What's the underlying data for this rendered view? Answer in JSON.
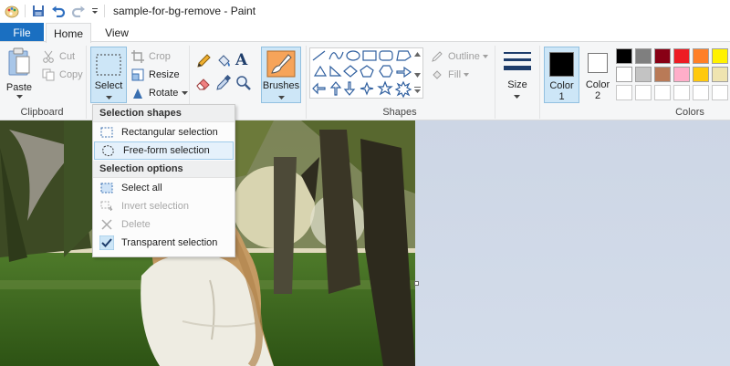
{
  "window": {
    "title": "sample-for-bg-remove - Paint"
  },
  "tabs": {
    "file": "File",
    "home": "Home",
    "view": "View"
  },
  "clipboard": {
    "paste": "Paste",
    "cut": "Cut",
    "copy": "Copy",
    "label": "Clipboard"
  },
  "image": {
    "select": "Select",
    "crop": "Crop",
    "resize": "Resize",
    "rotate": "Rotate"
  },
  "tools": {
    "brushes": "Brushes"
  },
  "shapes": {
    "outline": "Outline",
    "fill": "Fill",
    "label": "Shapes"
  },
  "size": {
    "label": "Size"
  },
  "colors": {
    "color1": "Color",
    "color1_num": "1",
    "color2": "Color",
    "color2_num": "2",
    "label": "Colors",
    "color1_value": "#000000",
    "color2_value": "#ffffff",
    "palette_row1": [
      "#000000",
      "#7f7f7f",
      "#880015",
      "#ed1c24",
      "#ff7f27",
      "#fff200"
    ],
    "palette_row2": [
      "#ffffff",
      "#c3c3c3",
      "#b97a57",
      "#ffaec9",
      "#ffc90e",
      "#efe4b0"
    ],
    "palette_row3": [
      "#ffffff",
      "#ffffff",
      "#ffffff",
      "#ffffff",
      "#ffffff",
      "#ffffff"
    ]
  },
  "select_menu": {
    "shapes_header": "Selection shapes",
    "rectangular": "Rectangular selection",
    "freeform": "Free-form selection",
    "options_header": "Selection options",
    "select_all": "Select all",
    "invert": "Invert selection",
    "delete": "Delete",
    "transparent": "Transparent selection"
  }
}
